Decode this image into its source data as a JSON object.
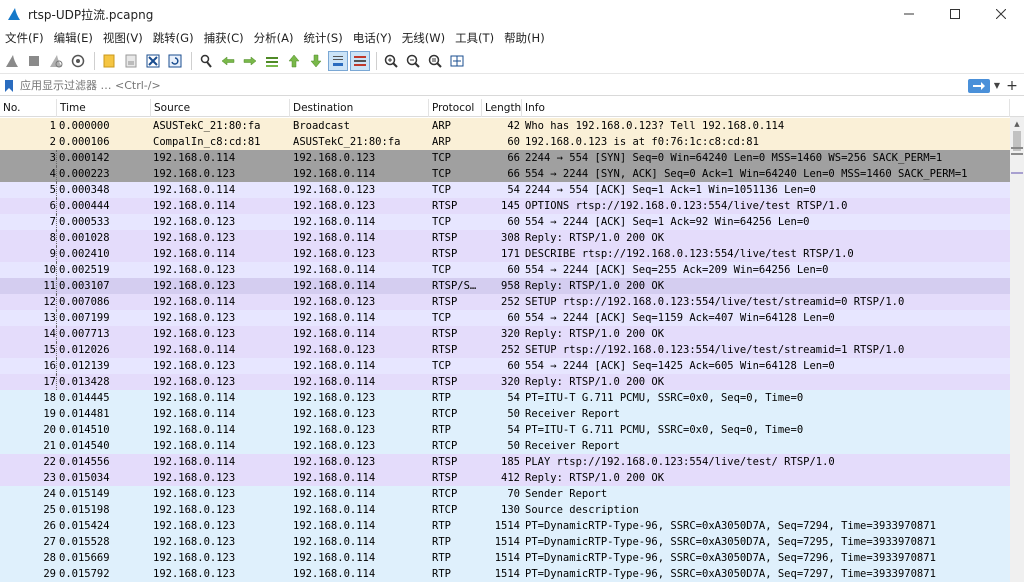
{
  "window": {
    "title": "rtsp-UDP拉流.pcapng",
    "minimize_glyph": "—",
    "maximize_glyph": "☐",
    "close_glyph": "✕"
  },
  "menu": [
    "文件(F)",
    "编辑(E)",
    "视图(V)",
    "跳转(G)",
    "捕获(C)",
    "分析(A)",
    "统计(S)",
    "电话(Y)",
    "无线(W)",
    "工具(T)",
    "帮助(H)"
  ],
  "toolbar": {
    "icons": [
      "shark-fin-start-icon",
      "stop-square-icon",
      "restart-fin-icon",
      "capture-options-gear-icon",
      "open-folder-icon",
      "save-file-icon",
      "close-file-icon",
      "reload-icon",
      "find-packet-icon",
      "go-back-icon",
      "go-forward-icon",
      "go-to-packet-icon",
      "go-first-icon",
      "go-last-icon",
      "auto-scroll-icon",
      "colorize-icon",
      "zoom-in-icon",
      "zoom-out-icon",
      "zoom-normal-icon",
      "resize-columns-icon"
    ]
  },
  "filter": {
    "placeholder": "应用显示过滤器 … <Ctrl-/>",
    "plus_glyph": "+",
    "drop_glyph": "▼"
  },
  "columns": [
    "No.",
    "Time",
    "Source",
    "Destination",
    "Protocol",
    "Length",
    "Info"
  ],
  "colors": {
    "arp": "#faf0d7",
    "tcp_syn": "#a0a0a0",
    "tcp": "#e7e6ff",
    "rtsp": "#e4dcfb",
    "rtsp_sdp": "#d4cdf0",
    "rtp": "#dff0fc",
    "rtcp": "#dff0fc"
  },
  "packets": [
    {
      "no": "1",
      "time": "0.000000",
      "src": "ASUSTekC_21:80:fa",
      "dst": "Broadcast",
      "proto": "ARP",
      "len": "42",
      "info": "Who has 192.168.0.123? Tell 192.168.0.114",
      "color": "arp"
    },
    {
      "no": "2",
      "time": "0.000106",
      "src": "CompalIn_c8:cd:81",
      "dst": "ASUSTekC_21:80:fa",
      "proto": "ARP",
      "len": "60",
      "info": "192.168.0.123 is at f0:76:1c:c8:cd:81",
      "color": "arp"
    },
    {
      "no": "3",
      "time": "0.000142",
      "src": "192.168.0.114",
      "dst": "192.168.0.123",
      "proto": "TCP",
      "len": "66",
      "info": "2244 → 554 [SYN] Seq=0 Win=64240 Len=0 MSS=1460 WS=256 SACK_PERM=1",
      "color": "tcp_syn"
    },
    {
      "no": "4",
      "time": "0.000223",
      "src": "192.168.0.123",
      "dst": "192.168.0.114",
      "proto": "TCP",
      "len": "66",
      "info": "554 → 2244 [SYN, ACK] Seq=0 Ack=1 Win=64240 Len=0 MSS=1460 SACK_PERM=1",
      "color": "tcp_syn"
    },
    {
      "no": "5",
      "time": "0.000348",
      "src": "192.168.0.114",
      "dst": "192.168.0.123",
      "proto": "TCP",
      "len": "54",
      "info": "2244 → 554 [ACK] Seq=1 Ack=1 Win=1051136 Len=0",
      "color": "tcp"
    },
    {
      "no": "6",
      "time": "0.000444",
      "src": "192.168.0.114",
      "dst": "192.168.0.123",
      "proto": "RTSP",
      "len": "145",
      "info": "OPTIONS rtsp://192.168.0.123:554/live/test RTSP/1.0",
      "color": "rtsp"
    },
    {
      "no": "7",
      "time": "0.000533",
      "src": "192.168.0.123",
      "dst": "192.168.0.114",
      "proto": "TCP",
      "len": "60",
      "info": "554 → 2244 [ACK] Seq=1 Ack=92 Win=64256 Len=0",
      "color": "tcp"
    },
    {
      "no": "8",
      "time": "0.001028",
      "src": "192.168.0.123",
      "dst": "192.168.0.114",
      "proto": "RTSP",
      "len": "308",
      "info": "Reply: RTSP/1.0 200 OK",
      "color": "rtsp"
    },
    {
      "no": "9",
      "time": "0.002410",
      "src": "192.168.0.114",
      "dst": "192.168.0.123",
      "proto": "RTSP",
      "len": "171",
      "info": "DESCRIBE rtsp://192.168.0.123:554/live/test RTSP/1.0",
      "color": "rtsp"
    },
    {
      "no": "10",
      "time": "0.002519",
      "src": "192.168.0.123",
      "dst": "192.168.0.114",
      "proto": "TCP",
      "len": "60",
      "info": "554 → 2244 [ACK] Seq=255 Ack=209 Win=64256 Len=0",
      "color": "tcp"
    },
    {
      "no": "11",
      "time": "0.003107",
      "src": "192.168.0.123",
      "dst": "192.168.0.114",
      "proto": "RTSP/S…",
      "len": "958",
      "info": "Reply: RTSP/1.0 200 OK",
      "color": "rtsp_sdp"
    },
    {
      "no": "12",
      "time": "0.007086",
      "src": "192.168.0.114",
      "dst": "192.168.0.123",
      "proto": "RTSP",
      "len": "252",
      "info": "SETUP rtsp://192.168.0.123:554/live/test/streamid=0 RTSP/1.0",
      "color": "rtsp"
    },
    {
      "no": "13",
      "time": "0.007199",
      "src": "192.168.0.123",
      "dst": "192.168.0.114",
      "proto": "TCP",
      "len": "60",
      "info": "554 → 2244 [ACK] Seq=1159 Ack=407 Win=64128 Len=0",
      "color": "tcp"
    },
    {
      "no": "14",
      "time": "0.007713",
      "src": "192.168.0.123",
      "dst": "192.168.0.114",
      "proto": "RTSP",
      "len": "320",
      "info": "Reply: RTSP/1.0 200 OK",
      "color": "rtsp"
    },
    {
      "no": "15",
      "time": "0.012026",
      "src": "192.168.0.114",
      "dst": "192.168.0.123",
      "proto": "RTSP",
      "len": "252",
      "info": "SETUP rtsp://192.168.0.123:554/live/test/streamid=1 RTSP/1.0",
      "color": "rtsp"
    },
    {
      "no": "16",
      "time": "0.012139",
      "src": "192.168.0.123",
      "dst": "192.168.0.114",
      "proto": "TCP",
      "len": "60",
      "info": "554 → 2244 [ACK] Seq=1425 Ack=605 Win=64128 Len=0",
      "color": "tcp"
    },
    {
      "no": "17",
      "time": "0.013428",
      "src": "192.168.0.123",
      "dst": "192.168.0.114",
      "proto": "RTSP",
      "len": "320",
      "info": "Reply: RTSP/1.0 200 OK",
      "color": "rtsp"
    },
    {
      "no": "18",
      "time": "0.014445",
      "src": "192.168.0.114",
      "dst": "192.168.0.123",
      "proto": "RTP",
      "len": "54",
      "info": "PT=ITU-T G.711 PCMU, SSRC=0x0, Seq=0, Time=0",
      "color": "rtp"
    },
    {
      "no": "19",
      "time": "0.014481",
      "src": "192.168.0.114",
      "dst": "192.168.0.123",
      "proto": "RTCP",
      "len": "50",
      "info": "Receiver Report",
      "color": "rtcp"
    },
    {
      "no": "20",
      "time": "0.014510",
      "src": "192.168.0.114",
      "dst": "192.168.0.123",
      "proto": "RTP",
      "len": "54",
      "info": "PT=ITU-T G.711 PCMU, SSRC=0x0, Seq=0, Time=0",
      "color": "rtp"
    },
    {
      "no": "21",
      "time": "0.014540",
      "src": "192.168.0.114",
      "dst": "192.168.0.123",
      "proto": "RTCP",
      "len": "50",
      "info": "Receiver Report",
      "color": "rtcp"
    },
    {
      "no": "22",
      "time": "0.014556",
      "src": "192.168.0.114",
      "dst": "192.168.0.123",
      "proto": "RTSP",
      "len": "185",
      "info": "PLAY rtsp://192.168.0.123:554/live/test/ RTSP/1.0",
      "color": "rtsp"
    },
    {
      "no": "23",
      "time": "0.015034",
      "src": "192.168.0.123",
      "dst": "192.168.0.114",
      "proto": "RTSP",
      "len": "412",
      "info": "Reply: RTSP/1.0 200 OK",
      "color": "rtsp"
    },
    {
      "no": "24",
      "time": "0.015149",
      "src": "192.168.0.123",
      "dst": "192.168.0.114",
      "proto": "RTCP",
      "len": "70",
      "info": "Sender Report",
      "color": "rtcp"
    },
    {
      "no": "25",
      "time": "0.015198",
      "src": "192.168.0.123",
      "dst": "192.168.0.114",
      "proto": "RTCP",
      "len": "130",
      "info": "Source description",
      "color": "rtcp"
    },
    {
      "no": "26",
      "time": "0.015424",
      "src": "192.168.0.123",
      "dst": "192.168.0.114",
      "proto": "RTP",
      "len": "1514",
      "info": "PT=DynamicRTP-Type-96, SSRC=0xA3050D7A, Seq=7294, Time=3933970871",
      "color": "rtp"
    },
    {
      "no": "27",
      "time": "0.015528",
      "src": "192.168.0.123",
      "dst": "192.168.0.114",
      "proto": "RTP",
      "len": "1514",
      "info": "PT=DynamicRTP-Type-96, SSRC=0xA3050D7A, Seq=7295, Time=3933970871",
      "color": "rtp"
    },
    {
      "no": "28",
      "time": "0.015669",
      "src": "192.168.0.123",
      "dst": "192.168.0.114",
      "proto": "RTP",
      "len": "1514",
      "info": "PT=DynamicRTP-Type-96, SSRC=0xA3050D7A, Seq=7296, Time=3933970871",
      "color": "rtp"
    },
    {
      "no": "29",
      "time": "0.015792",
      "src": "192.168.0.123",
      "dst": "192.168.0.114",
      "proto": "RTP",
      "len": "1514",
      "info": "PT=DynamicRTP-Type-96, SSRC=0xA3050D7A, Seq=7297, Time=3933970871",
      "color": "rtp"
    }
  ]
}
